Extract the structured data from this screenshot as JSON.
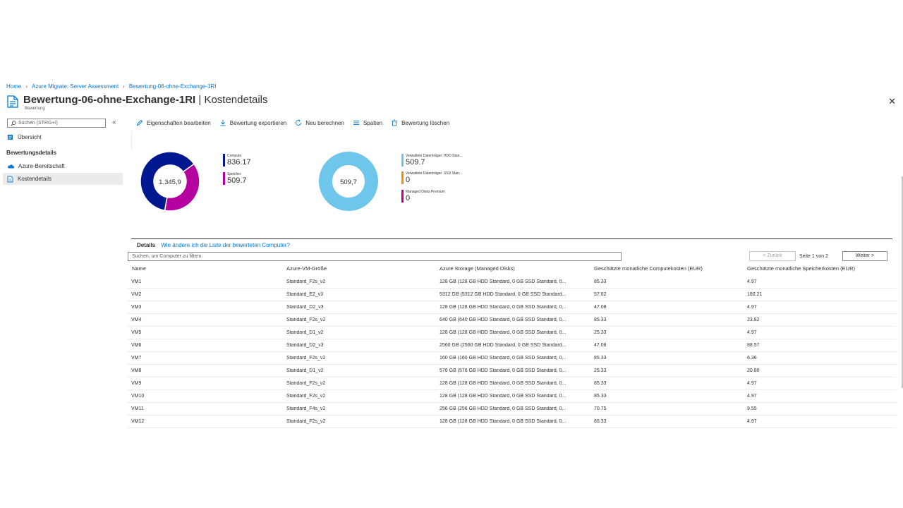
{
  "breadcrumb": {
    "items": [
      "Home",
      "Azure Migrate: Server Assessment",
      "Bewertung-06-ohne-Exchange-1RI"
    ]
  },
  "header": {
    "title_main": "Bewertung-06-ohne-Exchange-1RI",
    "title_sep": " | ",
    "title_section": "Kostendetails",
    "subtitle": "Bewertung"
  },
  "sidebar": {
    "search_placeholder": "Suchen (STRG+/)",
    "overview": "Übersicht",
    "section": "Bewertungsdetails",
    "items": [
      {
        "label": "Azure-Bereitschaft",
        "icon": "cloud-icon"
      },
      {
        "label": "Kostendetails",
        "icon": "document-icon"
      }
    ]
  },
  "toolbar": {
    "edit": "Eigenschaften bearbeiten",
    "export": "Bewertung exportieren",
    "recalc": "Neu berechnen",
    "columns": "Spalten",
    "delete": "Bewertung löschen"
  },
  "colors": {
    "compute": "#00188f",
    "storage": "#b4009e",
    "hdd": "#6ec6ea",
    "ssd": "#ff8c00",
    "premium": "#b4009e"
  },
  "compute_chart": {
    "center": "1.345,9",
    "legend": [
      {
        "label": "Compute",
        "value": "836.17"
      },
      {
        "label": "Speicher",
        "value": "509.7"
      }
    ],
    "values": [
      836.17,
      509.7
    ]
  },
  "storage_chart": {
    "center": "509,7",
    "legend": [
      {
        "label": "Verwaltete Datenträger: HDD Stan...",
        "value": "509.7"
      },
      {
        "label": "Verwaltete Datenträger: SSD Stan...",
        "value": "0"
      },
      {
        "label": "Managed Disks Premium",
        "value": "0"
      }
    ],
    "values": [
      509.7,
      0,
      0
    ]
  },
  "details": {
    "label": "Details",
    "link": "Wie ändere ich die Liste der bewerteten Computer?",
    "search_placeholder": "Suchen, um Computer zu filtern.",
    "prev": "< Zurück",
    "page_info": "Seite 1 von 2",
    "next": "Weiter >"
  },
  "table": {
    "headers": [
      "Name",
      "Azure-VM-Größe",
      "Azure Storage (Managed Disks)",
      "Geschätzte monatliche Computekosten (EUR)",
      "Geschätzte monatliche Speicherkosten (EUR)"
    ],
    "rows": [
      [
        "VM1",
        "Standard_F2s_v2",
        "128 GB (128 GB HDD Standard, 0 GB SSD Standard, 0...",
        "85.33",
        "4.97"
      ],
      [
        "VM2",
        "Standard_E2_v3",
        "5312 GB (5312 GB HDD Standard, 0 GB SSD Standard...",
        "57.62",
        "180.21"
      ],
      [
        "VM3",
        "Standard_D2_v3",
        "128 GB (128 GB HDD Standard, 0 GB SSD Standard, 0...",
        "47.08",
        "4.97"
      ],
      [
        "VM4",
        "Standard_F2s_v2",
        "640 GB (640 GB HDD Standard, 0 GB SSD Standard, 0...",
        "85.33",
        "23.82"
      ],
      [
        "VM5",
        "Standard_D1_v2",
        "128 GB (128 GB HDD Standard, 0 GB SSD Standard, 0...",
        "25.33",
        "4.97"
      ],
      [
        "VM6",
        "Standard_D2_v3",
        "2560 GB (2560 GB HDD Standard, 0 GB SSD Standard...",
        "47.08",
        "88.57"
      ],
      [
        "VM7",
        "Standard_F2s_v2",
        "160 GB (160 GB HDD Standard, 0 GB SSD Standard, 0...",
        "85.33",
        "6.36"
      ],
      [
        "VM8",
        "Standard_D1_v2",
        "576 GB (576 GB HDD Standard, 0 GB SSD Standard, 0...",
        "25.33",
        "20.80"
      ],
      [
        "VM9",
        "Standard_F2s_v2",
        "128 GB (128 GB HDD Standard, 0 GB SSD Standard, 0...",
        "85.33",
        "4.97"
      ],
      [
        "VM10",
        "Standard_F2s_v2",
        "128 GB (128 GB HDD Standard, 0 GB SSD Standard, 0...",
        "85.33",
        "4.97"
      ],
      [
        "VM11",
        "Standard_F4s_v2",
        "256 GB (256 GB HDD Standard, 0 GB SSD Standard, 0...",
        "70.75",
        "9.55"
      ],
      [
        "VM12",
        "Standard_F2s_v2",
        "128 GB (128 GB HDD Standard, 0 GB SSD Standard, 0...",
        "85.33",
        "4.97"
      ]
    ]
  }
}
